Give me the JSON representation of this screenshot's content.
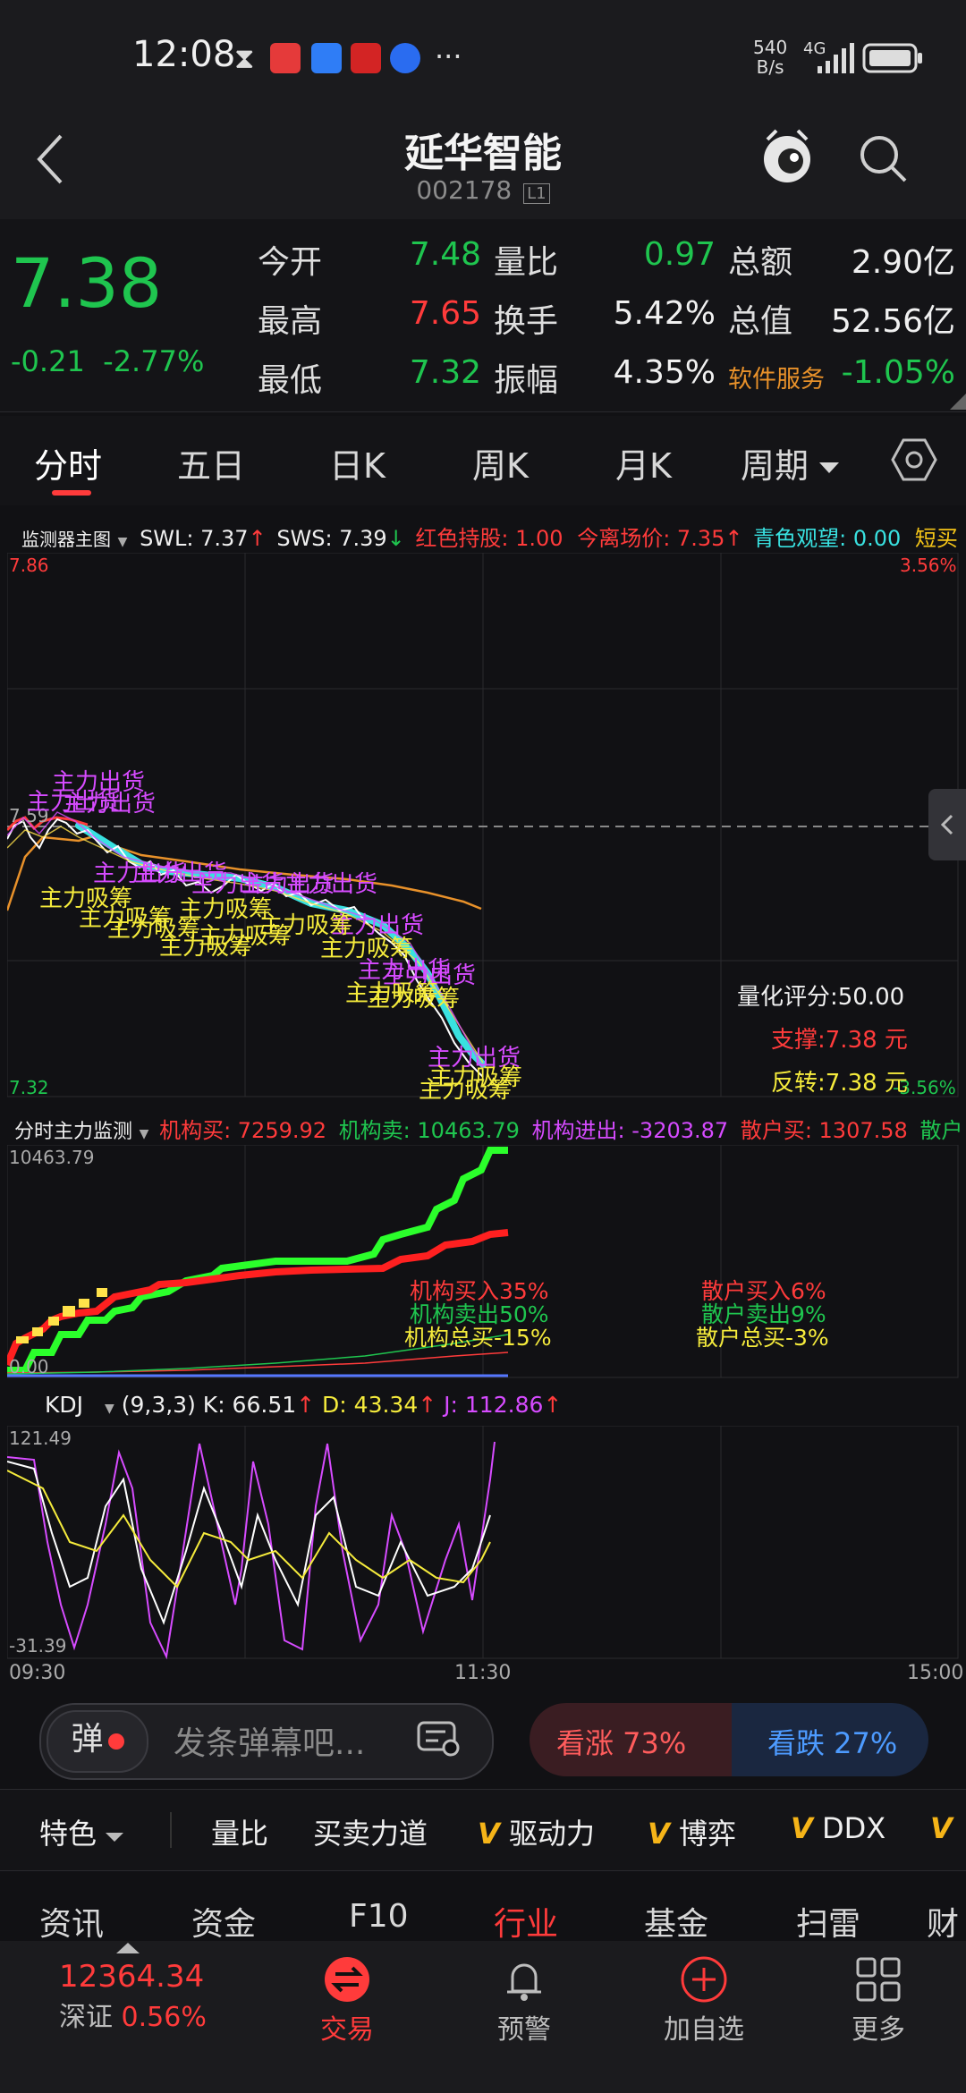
{
  "status_bar": {
    "time": "12:08",
    "net_speed_top": "540",
    "net_speed_bottom": "B/s",
    "network": "4G"
  },
  "header": {
    "title": "延华智能",
    "code": "002178",
    "code_badge": "L1"
  },
  "quote": {
    "price": "7.38",
    "change": "-0.21",
    "change_pct": "-2.77%",
    "rows": [
      {
        "l1": "今开",
        "v1": "7.48",
        "l2": "量比",
        "v2": "0.97",
        "l3": "总额",
        "v3": "2.90亿"
      },
      {
        "l1": "最高",
        "v1": "7.65",
        "l2": "换手",
        "v2": "5.42%",
        "l3": "总值",
        "v3": "52.56亿"
      },
      {
        "l1": "最低",
        "v1": "7.32",
        "l2": "振幅",
        "v2": "4.35%",
        "l3": "软件服务",
        "v3": "-1.05%"
      }
    ]
  },
  "tabs": [
    "分时",
    "五日",
    "日K",
    "周K",
    "月K",
    "周期"
  ],
  "colors": {
    "up": "#ff3b3b",
    "down": "#1fc54f",
    "accent": "#ff3b3b"
  },
  "main_legend": {
    "name": "监测器主图",
    "swl": "SWL: 7.37",
    "sws": "SWS: 7.39",
    "hold": "红色持股: 1.00",
    "leave": "今离场价: 7.35",
    "watch": "青色观望: 0.00",
    "short": "短买"
  },
  "main_chart": {
    "top_left": "7.86",
    "top_right": "3.56%",
    "bottom_left": "7.32",
    "bottom_right": "-3.56%",
    "mid_label": "7.59",
    "score": "量化评分:50.00",
    "support": "支撑:7.38 元",
    "reverse": "反转:7.38 元",
    "sell_label": "主力出货",
    "buy_label": "主力吸筹"
  },
  "flow_legend": {
    "name": "分时主力监测",
    "inst_buy": "机构买: 7259.92",
    "inst_sell": "机构卖: 10463.79",
    "inst_net": "机构进出: -3203.87",
    "retail_buy": "散户买: 1307.58",
    "retail_more": "散户"
  },
  "flow_chart": {
    "top": "10463.79",
    "bottom": "0.00",
    "inst_buy_pct": "机构买入35%",
    "inst_sell_pct": "机构卖出50%",
    "inst_total": "机构总买-15%",
    "retail_buy_pct": "散户买入6%",
    "retail_sell_pct": "散户卖出9%",
    "retail_total": "散户总买-3%"
  },
  "kdj": {
    "name": "KDJ",
    "params": "(9,3,3)",
    "k": "K: 66.51",
    "d": "D: 43.34",
    "j": "J: 112.86",
    "top": "121.49",
    "bottom": "-31.39"
  },
  "time_axis": {
    "start": "09:30",
    "mid": "11:30",
    "end": "15:00"
  },
  "danmu": {
    "badge": "弹",
    "placeholder": "发条弹幕吧...",
    "bull": "看涨 73%",
    "bear": "看跌 27%"
  },
  "features": {
    "first": "特色",
    "items": [
      "量比",
      "买卖力道",
      "驱动力",
      "博弈",
      "DDX"
    ]
  },
  "info_tabs": [
    "资讯",
    "资金",
    "F10",
    "行业",
    "基金",
    "扫雷",
    "财"
  ],
  "footer": {
    "index_value": "12364.34",
    "index_name": "深证",
    "index_change": "0.56%",
    "buttons": [
      "交易",
      "预警",
      "加自选",
      "更多"
    ]
  }
}
